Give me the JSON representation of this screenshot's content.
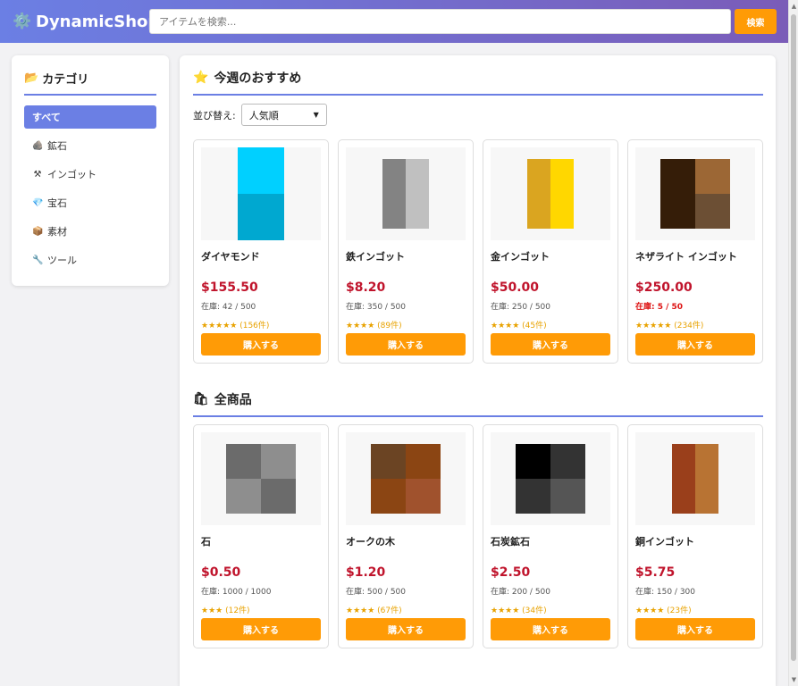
{
  "header": {
    "logo_icon": "gear-icon",
    "logo": "DynamicShop",
    "search_placeholder": "アイテムを検索...",
    "search_button": "検索"
  },
  "sidebar": {
    "title_icon": "📂",
    "title": "カテゴリ",
    "items": [
      {
        "icon": "",
        "label": "すべて",
        "active": true
      },
      {
        "icon": "🪨",
        "label": "鉱石",
        "active": false
      },
      {
        "icon": "⚒",
        "label": "インゴット",
        "active": false
      },
      {
        "icon": "💎",
        "label": "宝石",
        "active": false
      },
      {
        "icon": "📦",
        "label": "素材",
        "active": false
      },
      {
        "icon": "🔧",
        "label": "ツール",
        "active": false
      }
    ]
  },
  "featured": {
    "icon": "⭐",
    "title": "今週のおすすめ",
    "sort_label": "並び替え:",
    "sort_value": "人気順",
    "products": [
      {
        "name": "ダイヤモンド",
        "price": "$155.50",
        "stock": "在庫: 42 / 500",
        "low_stock": false,
        "stars": "★★★★★",
        "reviews": "(156件)",
        "colors": [
          "#00d0ff",
          "#00a8d0"
        ],
        "pattern": "v2"
      },
      {
        "name": "鉄インゴット",
        "price": "$8.20",
        "stock": "在庫: 350 / 500",
        "low_stock": false,
        "stars": "★★★★",
        "reviews": "(89件)",
        "colors": [
          "#838383",
          "#c0c0c0"
        ],
        "pattern": "h2"
      },
      {
        "name": "金インゴット",
        "price": "$50.00",
        "stock": "在庫: 250 / 500",
        "low_stock": false,
        "stars": "★★★★",
        "reviews": "(45件)",
        "colors": [
          "#daa520",
          "#ffd700"
        ],
        "pattern": "h2"
      },
      {
        "name": "ネザライト インゴット",
        "price": "$250.00",
        "stock": "在庫: 5 / 50",
        "low_stock": true,
        "stars": "★★★★★",
        "reviews": "(234件)",
        "colors": [
          "#351d08",
          "#9c6735",
          "#351d08",
          "#6c4f34"
        ],
        "pattern": "q4"
      }
    ]
  },
  "all": {
    "icon": "🛍",
    "title": "全商品",
    "products": [
      {
        "name": "石",
        "price": "$0.50",
        "stock": "在庫: 1000 / 1000",
        "low_stock": false,
        "stars": "★★★",
        "reviews": "(12件)",
        "colors": [
          "#6b6b6b",
          "#8e8e8e",
          "#8e8e8e",
          "#6b6b6b"
        ],
        "pattern": "q4"
      },
      {
        "name": "オークの木",
        "price": "$1.20",
        "stock": "在庫: 500 / 500",
        "low_stock": false,
        "stars": "★★★★",
        "reviews": "(67件)",
        "colors": [
          "#6b4423",
          "#8b4513",
          "#8b4513",
          "#a0522d"
        ],
        "pattern": "q4"
      },
      {
        "name": "石炭鉱石",
        "price": "$2.50",
        "stock": "在庫: 200 / 500",
        "low_stock": false,
        "stars": "★★★★",
        "reviews": "(34件)",
        "colors": [
          "#000000",
          "#333333",
          "#333333",
          "#555555"
        ],
        "pattern": "q4"
      },
      {
        "name": "銅インゴット",
        "price": "$5.75",
        "stock": "在庫: 150 / 300",
        "low_stock": false,
        "stars": "★★★★",
        "reviews": "(23件)",
        "colors": [
          "#9a3f1b",
          "#b87333"
        ],
        "pattern": "h2"
      }
    ]
  },
  "buy_label": "購入する",
  "colors": {
    "accent": "#6b7fe4",
    "buy": "#ff9b06",
    "price": "#c0142c",
    "star": "#e8a200"
  }
}
